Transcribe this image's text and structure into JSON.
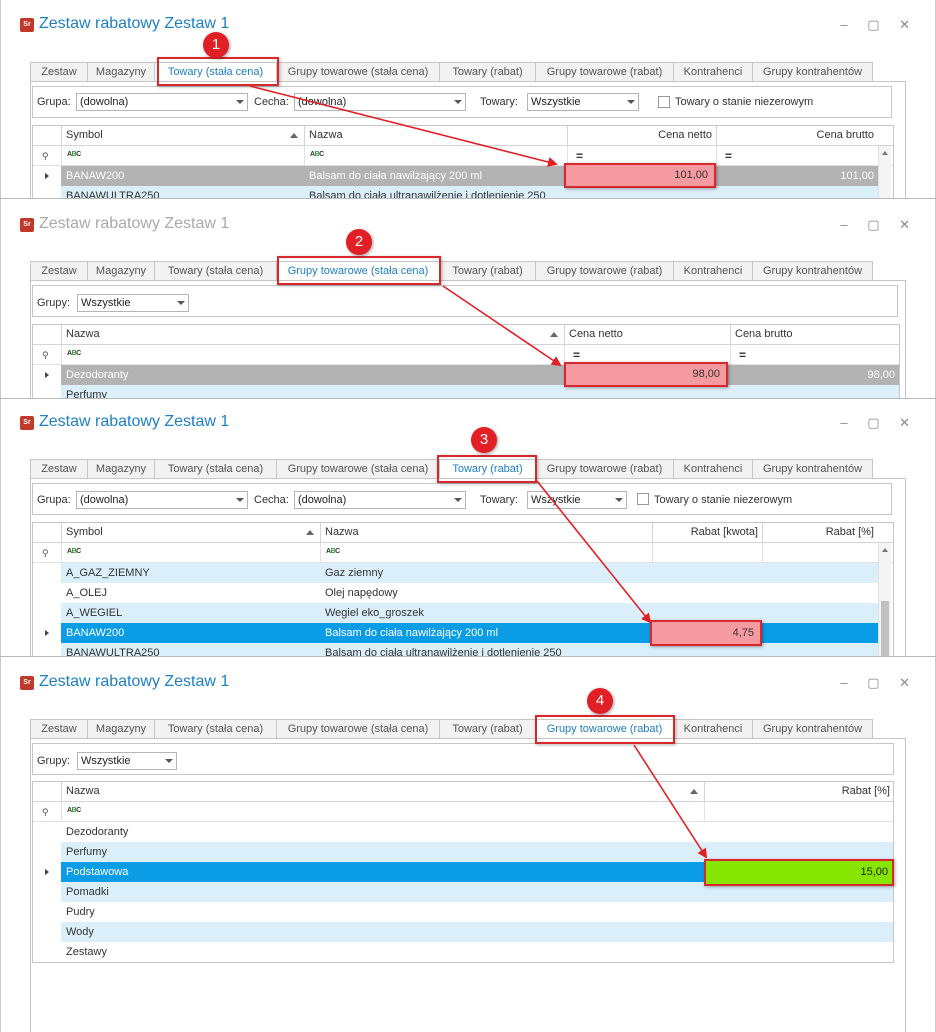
{
  "colors": {
    "accent": "#1e7fc3",
    "highlight_red": "#f59aa0",
    "highlight_green": "#86e600",
    "selected_row": "#0a9de6",
    "arrow": "#e31f26"
  },
  "app_icon": "Sr",
  "window_controls": "‒ ▢ ✕",
  "tabs": [
    "Zestaw",
    "Magazyny",
    "Towary (stała cena)",
    "Grupy towarowe (stała cena)",
    "Towary (rabat)",
    "Grupy towarowe (rabat)",
    "Kontrahenci",
    "Grupy kontrahentów"
  ],
  "panels": [
    {
      "badge": "1",
      "title": "Zestaw rabatowy Zestaw 1",
      "selected_tab": "Towary (stała cena)",
      "filters": {
        "grupa_label": "Grupa:",
        "grupa_value": "(dowolna)",
        "cecha_label": "Cecha:",
        "cecha_value": "(dowolna)",
        "towary_label": "Towary:",
        "towary_value": "Wszystkie",
        "checkbox_label": "Towary o stanie niezerowym"
      },
      "columns": [
        "Symbol",
        "Nazwa",
        "Cena netto",
        "Cena brutto"
      ],
      "rows": [
        [
          "BANAW200",
          "Balsam do ciała nawilżający 200 ml",
          "101,00",
          "101,00"
        ],
        [
          "BANAWULTRA250",
          "Balsam do ciała ultranawilżenie i dotlenienie 250",
          "",
          ""
        ]
      ]
    },
    {
      "badge": "2",
      "title": "Zestaw rabatowy Zestaw 1",
      "selected_tab": "Grupy towarowe (stała cena)",
      "filters": {
        "grupy_label": "Grupy:",
        "grupy_value": "Wszystkie"
      },
      "columns": [
        "Nazwa",
        "Cena netto",
        "Cena brutto"
      ],
      "rows": [
        [
          "Dezodoranty",
          "98,00",
          "98,00"
        ],
        [
          "Perfumy",
          "",
          ""
        ]
      ]
    },
    {
      "badge": "3",
      "title": "Zestaw rabatowy Zestaw 1",
      "selected_tab": "Towary (rabat)",
      "filters": {
        "grupa_label": "Grupa:",
        "grupa_value": "(dowolna)",
        "cecha_label": "Cecha:",
        "cecha_value": "(dowolna)",
        "towary_label": "Towary:",
        "towary_value": "Wszystkie",
        "checkbox_label": "Towary o stanie niezerowym"
      },
      "columns": [
        "Symbol",
        "Nazwa",
        "Rabat [kwota]",
        "Rabat [%]"
      ],
      "rows": [
        [
          "A_GAZ_ZIEMNY",
          "Gaz ziemny",
          "",
          ""
        ],
        [
          "A_OLEJ",
          "Olej napędowy",
          "",
          ""
        ],
        [
          "A_WEGIEL",
          "Wegiel eko_groszek",
          "",
          ""
        ],
        [
          "BANAW200",
          "Balsam do ciała nawilżający 200 ml",
          "4,75",
          ""
        ],
        [
          "BANAWULTRA250",
          "Balsam do ciała ultranawilżenie i dotlenienie 250",
          "",
          ""
        ]
      ]
    },
    {
      "badge": "4",
      "title": "Zestaw rabatowy Zestaw 1",
      "selected_tab": "Grupy towarowe (rabat)",
      "filters": {
        "grupy_label": "Grupy:",
        "grupy_value": "Wszystkie"
      },
      "columns": [
        "Nazwa",
        "Rabat [%]"
      ],
      "rows": [
        [
          "Dezodoranty",
          ""
        ],
        [
          "Perfumy",
          ""
        ],
        [
          "Podstawowa",
          "15,00"
        ],
        [
          "Pomadki",
          ""
        ],
        [
          "Pudry",
          ""
        ],
        [
          "Wody",
          ""
        ],
        [
          "Zestawy",
          ""
        ]
      ]
    }
  ]
}
